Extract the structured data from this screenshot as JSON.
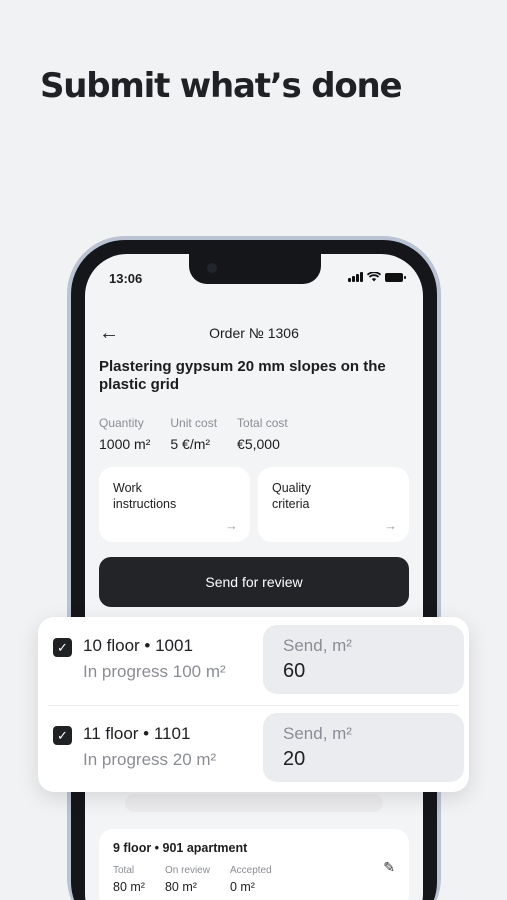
{
  "headline": "Submit what’s done",
  "status": {
    "time": "13:06"
  },
  "header": {
    "title": "Order № 1306"
  },
  "job": {
    "title": "Plastering gypsum 20 mm slopes on the plastic grid"
  },
  "stats": [
    {
      "label": "Quantity",
      "value": "1000 m²"
    },
    {
      "label": "Unit cost",
      "value": "5 €/m²"
    },
    {
      "label": "Total cost",
      "value": "€5,000"
    }
  ],
  "cards": [
    {
      "label": "Work instructions"
    },
    {
      "label": "Quality criteria"
    }
  ],
  "send_button": "Send for review",
  "rows": [
    {
      "title": "10 floor • 1001",
      "status": "In progress 100 m²",
      "send_label": "Send, m²",
      "send_value": "60",
      "checked": true
    },
    {
      "title": "11 floor • 1101",
      "status": "In progress 20 m²",
      "send_label": "Send, m²",
      "send_value": "20",
      "checked": true
    }
  ],
  "item": {
    "title": "9 floor • 901 apartment",
    "stats": [
      {
        "label": "Total",
        "value": "80 m²"
      },
      {
        "label": "On review",
        "value": "80 m²"
      },
      {
        "label": "Accepted",
        "value": "0 m²"
      }
    ]
  },
  "icons": {
    "back": "arrow-left-icon",
    "arrow": "arrow-right-icon",
    "edit": "pencil-icon",
    "check": "checkbox-checked-icon"
  }
}
